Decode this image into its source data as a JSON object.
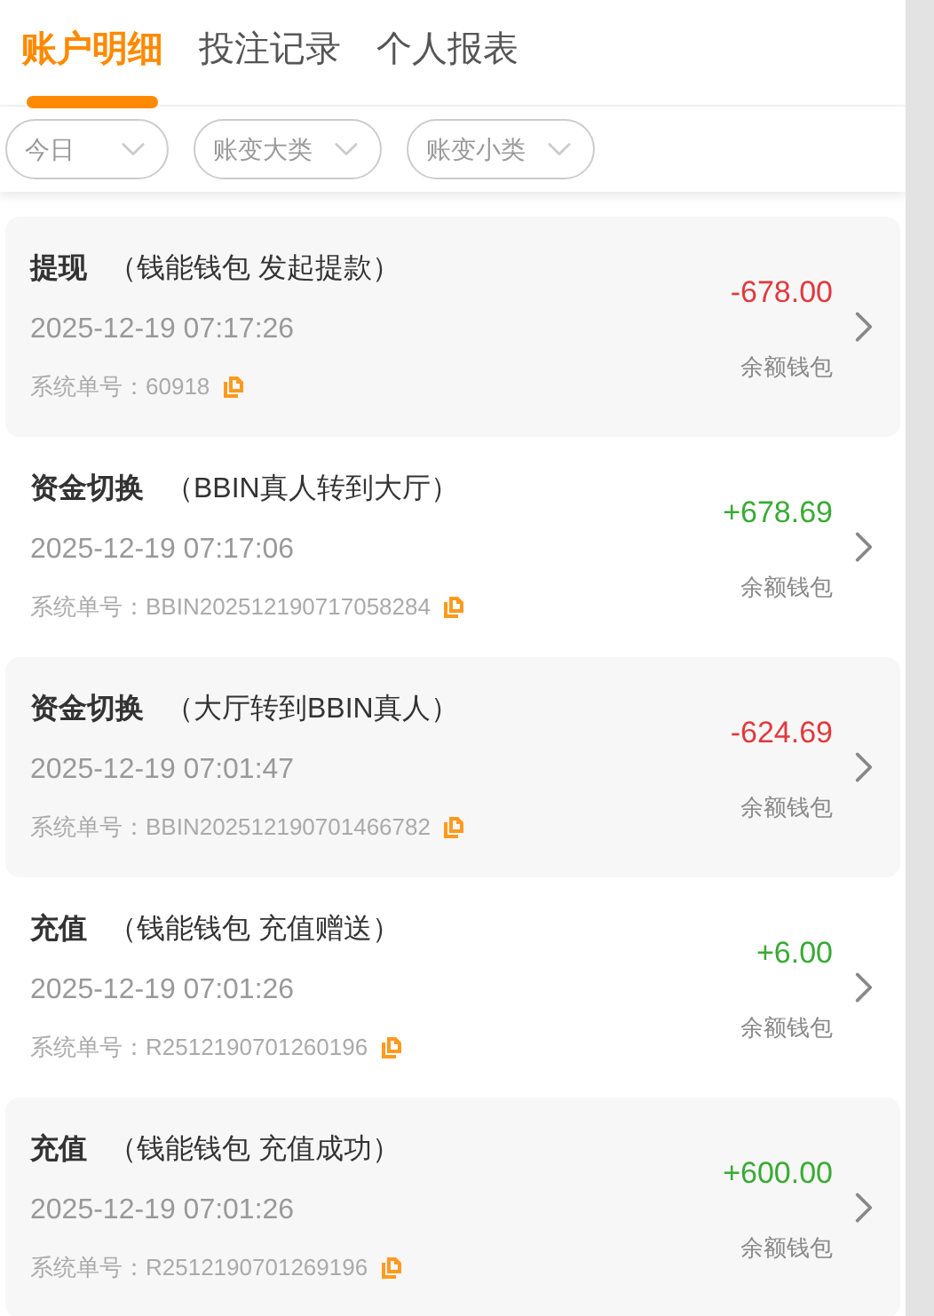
{
  "tabs": [
    {
      "label": "账户明细",
      "selected": true
    },
    {
      "label": "投注记录",
      "selected": false
    },
    {
      "label": "个人报表",
      "selected": false
    }
  ],
  "filters": [
    {
      "label": "今日"
    },
    {
      "label": "账变大类"
    },
    {
      "label": "账变小类"
    }
  ],
  "records": [
    {
      "type": "提现",
      "detail": "（钱能钱包 发起提款）",
      "time": "2025-12-19 07:17:26",
      "order_no": "系统单号：60918",
      "amount": "-678.00",
      "color": "#e0393e",
      "wallet": "余额钱包"
    },
    {
      "type": "资金切换",
      "detail": "（BBIN真人转到大厅）",
      "time": "2025-12-19 07:17:06",
      "order_no": "系统单号：BBIN202512190717058284",
      "amount": "+678.69",
      "color": "#3aaa35",
      "wallet": "余额钱包"
    },
    {
      "type": "资金切换",
      "detail": "（大厅转到BBIN真人）",
      "time": "2025-12-19 07:01:47",
      "order_no": "系统单号：BBIN202512190701466782",
      "amount": "-624.69",
      "color": "#e0393e",
      "wallet": "余额钱包"
    },
    {
      "type": "充值",
      "detail": "（钱能钱包 充值赠送）",
      "time": "2025-12-19 07:01:26",
      "order_no": "系统单号：R2512190701260196",
      "amount": "+6.00",
      "color": "#3aaa35",
      "wallet": "余额钱包"
    },
    {
      "type": "充值",
      "detail": "（钱能钱包 充值成功）",
      "time": "2025-12-19 07:01:26",
      "order_no": "系统单号：R2512190701269196",
      "amount": "+600.00",
      "color": "#3aaa35",
      "wallet": "余额钱包"
    }
  ]
}
